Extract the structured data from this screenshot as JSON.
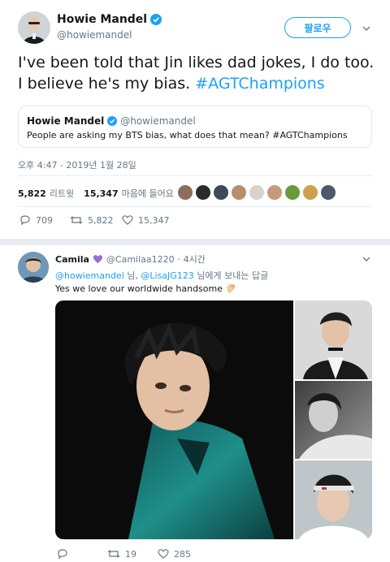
{
  "tweet": {
    "author_name": "Howie Mandel",
    "author_handle": "@howiemandel",
    "follow_label": "팔로우",
    "text_plain": "I've been told that Jin likes dad jokes, I do too. I believe he's my bias. ",
    "hashtag": "#AGTChampions",
    "timestamp": "오후 4:47 - 2019년 1월 28일",
    "retweets_count": "5,822",
    "retweets_label": "리트윗",
    "likes_count": "15,347",
    "likes_label": "마음에 들어요"
  },
  "quote": {
    "author_name": "Howie Mandel",
    "author_handle": "@howiemandel",
    "text": "People are asking my BTS bias, what does that mean? #AGTChampions"
  },
  "actions": {
    "replies": "709",
    "retweets": "5,822",
    "likes": "15,347"
  },
  "reply": {
    "author_name": "Camila",
    "author_handle": "@Camilaa1220",
    "time": "· 4시간",
    "mention1": "@howiemandel",
    "joiner": "님,",
    "mention2": "@LisaJG123",
    "suffix": "님에게 보내는 답글",
    "text": "Yes we love our worldwide handsome",
    "actions": {
      "replies": "",
      "retweets": "19",
      "likes": "285"
    }
  },
  "colors": {
    "brand_blue": "#1da1f2",
    "verified_blue": "#1da1f2",
    "text_primary": "#14171a",
    "text_secondary": "#657786",
    "border": "#e1e8ed",
    "heart_purple": "#9b6bd0"
  }
}
